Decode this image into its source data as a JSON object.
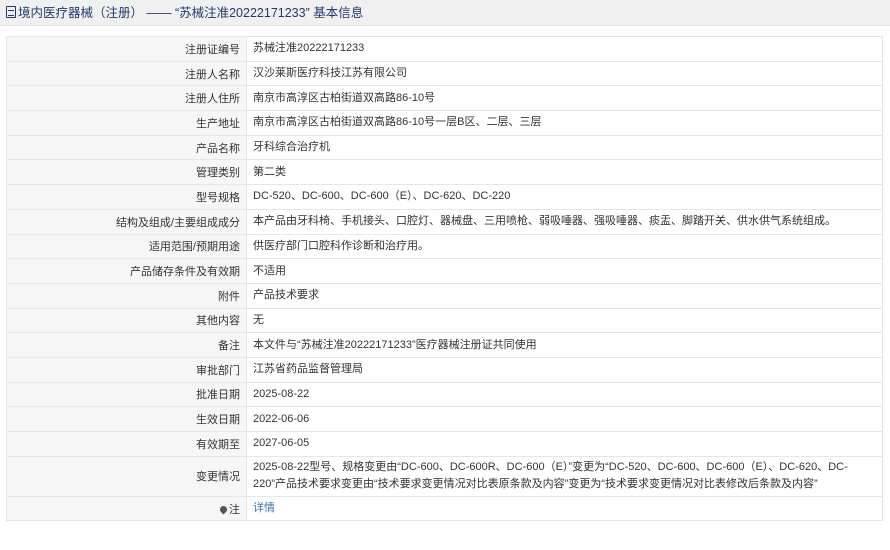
{
  "header": {
    "title": "境内医疗器械（注册） —— “苏械注准20222171233” 基本信息"
  },
  "rows": [
    {
      "label": "注册证编号",
      "value": "苏械注准20222171233"
    },
    {
      "label": "注册人名称",
      "value": "汉沙莱斯医疗科技江苏有限公司"
    },
    {
      "label": "注册人住所",
      "value": "南京市高淳区古柏街道双高路86-10号"
    },
    {
      "label": "生产地址",
      "value": "南京市高淳区古柏街道双高路86-10号一层B区、二层、三层"
    },
    {
      "label": "产品名称",
      "value": "牙科综合治疗机"
    },
    {
      "label": "管理类别",
      "value": "第二类"
    },
    {
      "label": "型号规格",
      "value": "DC-520、DC-600、DC-600（E）、DC-620、DC-220"
    },
    {
      "label": "结构及组成/主要组成成分",
      "value": "本产品由牙科椅、手机接头、口腔灯、器械盘、三用喷枪、弱吸唾器、强吸唾器、痰盂、脚踏开关、供水供气系统组成。"
    },
    {
      "label": "适用范围/预期用途",
      "value": "供医疗部门口腔科作诊断和治疗用。"
    },
    {
      "label": "产品储存条件及有效期",
      "value": "不适用"
    },
    {
      "label": "附件",
      "value": "产品技术要求"
    },
    {
      "label": "其他内容",
      "value": "无"
    },
    {
      "label": "备注",
      "value": "本文件与“苏械注准20222171233”医疗器械注册证共同使用"
    },
    {
      "label": "审批部门",
      "value": "江苏省药品监督管理局"
    },
    {
      "label": "批准日期",
      "value": "2025-08-22"
    },
    {
      "label": "生效日期",
      "value": "2022-06-06"
    },
    {
      "label": "有效期至",
      "value": "2027-06-05"
    },
    {
      "label": "变更情况",
      "value": "2025-08-22型号、规格变更由“DC-600、DC-600R、DC-600（E）”变更为“DC-520、DC-600、DC-600（E）、DC-620、DC-220”产品技术要求变更由“技术要求变更情况对比表原条款及内容”变更为“技术要求变更情况对比表修改后条款及内容”"
    }
  ],
  "note": {
    "label": "注",
    "link_text": "详情"
  },
  "icons": {
    "header": "document-icon",
    "note": "pin-icon"
  },
  "colors": {
    "header_text": "#1f3a6e",
    "link": "#3a6fb7",
    "label_bg": "#f6f6f6"
  }
}
